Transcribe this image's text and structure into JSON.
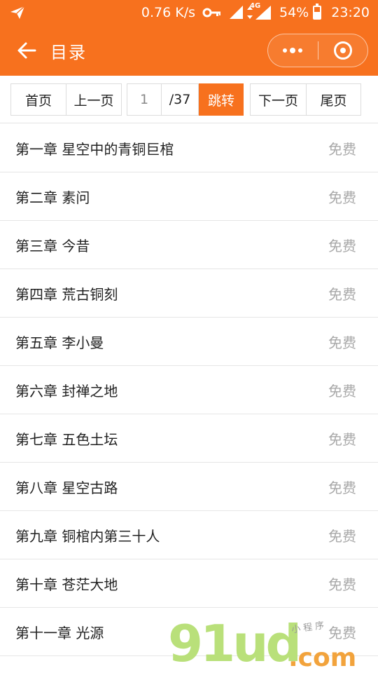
{
  "status_bar": {
    "speed": "0.76 K/s",
    "network": "4G",
    "battery": "54%",
    "battery_level": 0.54,
    "time": "23:20",
    "icons": [
      "send-icon",
      "key-icon",
      "signal-icon",
      "data-arrows-icon",
      "signal-4g-icon",
      "battery-icon"
    ]
  },
  "nav": {
    "title": "目录",
    "back_icon": "arrow-left-icon",
    "more_icon": "more-dots-icon",
    "close_icon": "target-circle-icon"
  },
  "pager": {
    "first": "首页",
    "prev": "上一页",
    "page_value": "1",
    "total": "/37",
    "jump": "跳转",
    "next": "下一页",
    "last": "尾页"
  },
  "chapters": [
    {
      "title": "第一章 星空中的青铜巨棺",
      "tag": "免费"
    },
    {
      "title": "第二章 素问",
      "tag": "免费"
    },
    {
      "title": "第三章 今昔",
      "tag": "免费"
    },
    {
      "title": "第四章 荒古铜刻",
      "tag": "免费"
    },
    {
      "title": "第五章 李小曼",
      "tag": "免费"
    },
    {
      "title": "第六章 封禅之地",
      "tag": "免费"
    },
    {
      "title": "第七章 五色土坛",
      "tag": "免费"
    },
    {
      "title": "第八章 星空古路",
      "tag": "免费"
    },
    {
      "title": "第九章 铜棺内第三十人",
      "tag": "免费"
    },
    {
      "title": "第十章 苍茫大地",
      "tag": "免费"
    },
    {
      "title": "第十一章 光源",
      "tag": "免费"
    }
  ],
  "watermark": {
    "logo": "91ud",
    "suffix": ".com",
    "slogan": "小程序"
  },
  "colors": {
    "accent": "#f7711e",
    "tag_gray": "#a9a9a9",
    "divider": "#e6e6e6"
  }
}
